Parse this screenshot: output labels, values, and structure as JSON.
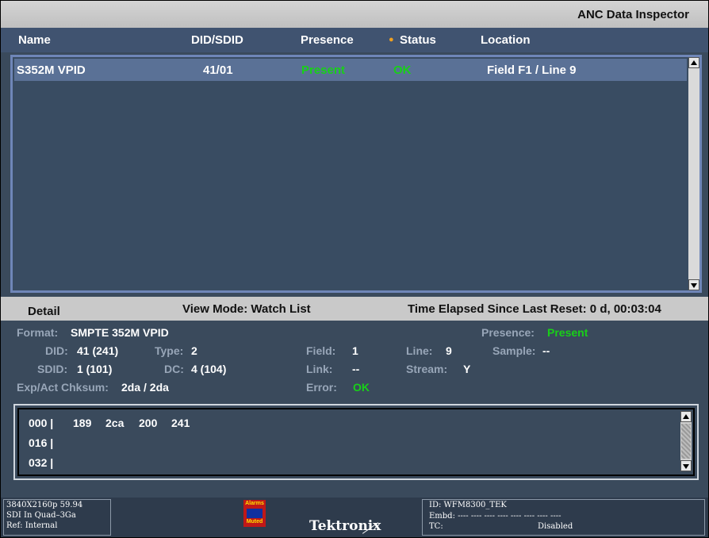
{
  "window": {
    "title": "ANC Data Inspector"
  },
  "columns": {
    "name": "Name",
    "did_sdid": "DID/SDID",
    "presence": "Presence",
    "status_dot": "●",
    "status": "Status",
    "location": "Location"
  },
  "rows": [
    {
      "name": "S352M VPID",
      "did_sdid": "41/01",
      "presence": "Present",
      "status": "OK",
      "location": "Field F1 / Line 9"
    }
  ],
  "detail_bar": {
    "detail": "Detail",
    "view_mode": "View Mode: Watch List",
    "elapsed": "Time Elapsed Since Last Reset: 0 d, 00:03:04"
  },
  "detail": {
    "format_label": "Format:",
    "format_value": "SMPTE 352M VPID",
    "presence_label": "Presence:",
    "presence_value": "Present",
    "did_label": "DID:",
    "did_value": "41 (241)",
    "type_label": "Type:",
    "type_value": "2",
    "field_label": "Field:",
    "field_value": "1",
    "line_label": "Line:",
    "line_value": "9",
    "sample_label": "Sample:",
    "sample_value": "--",
    "sdid_label": "SDID:",
    "sdid_value": "1 (101)",
    "dc_label": "DC:",
    "dc_value": "4 (104)",
    "link_label": "Link:",
    "link_value": "--",
    "stream_label": "Stream:",
    "stream_value": "Y",
    "chksum_label": "Exp/Act Chksum:",
    "chksum_value": "2da / 2da",
    "error_label": "Error:",
    "error_value": "OK"
  },
  "hex": {
    "lines": [
      {
        "offset": "000 |",
        "values": [
          "189",
          "2ca",
          "200",
          "241"
        ]
      },
      {
        "offset": "016 |",
        "values": []
      },
      {
        "offset": "032 |",
        "values": []
      }
    ]
  },
  "footer": {
    "format": "3840X2160p 59.94",
    "input": "SDI In Quad–3Ga",
    "ref": "Ref: Internal",
    "alarm_top": "Alarms",
    "alarm_bottom": "Muted",
    "brand": "Tektronix",
    "id": "ID: WFM8300_TEK",
    "embd": "Embd: ---- ---- ---- ---- ---- ---- ---- ----",
    "tc_label": "TC:",
    "tc_value": "Disabled"
  },
  "colors": {
    "accent_green": "#18d018",
    "row_select": "#5a7196",
    "header_blue": "#405370",
    "panel": "#3a4a5c"
  },
  "icons": {
    "status_dot": "orange-dot-icon",
    "scroll_up": "scroll-up-arrow-icon",
    "scroll_down": "scroll-down-arrow-icon",
    "alarm": "alarm-muted-icon"
  }
}
